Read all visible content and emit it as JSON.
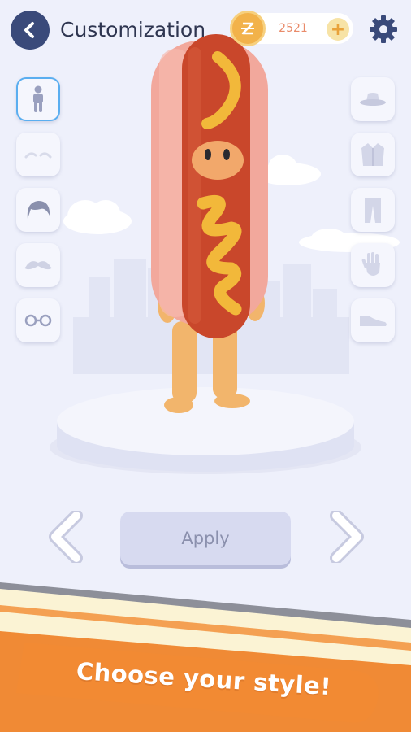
{
  "header": {
    "title": "Customization",
    "coins": "2521",
    "add_coin_label": "+",
    "back_icon": "chevron-left-icon",
    "settings_icon": "gear-icon"
  },
  "left_slots": [
    {
      "name": "body",
      "icon": "person-icon",
      "selected": true
    },
    {
      "name": "eyebrows",
      "icon": "eyebrows-icon",
      "selected": false
    },
    {
      "name": "hair",
      "icon": "hair-icon",
      "selected": false
    },
    {
      "name": "mustache",
      "icon": "mustache-icon",
      "selected": false
    },
    {
      "name": "glasses",
      "icon": "glasses-icon",
      "selected": false
    }
  ],
  "right_slots": [
    {
      "name": "hat",
      "icon": "hat-icon"
    },
    {
      "name": "jacket",
      "icon": "jacket-icon"
    },
    {
      "name": "pants",
      "icon": "pants-icon"
    },
    {
      "name": "gloves",
      "icon": "glove-icon"
    },
    {
      "name": "shoes",
      "icon": "shoe-icon"
    }
  ],
  "character": {
    "costume": "hot-dog-costume"
  },
  "controls": {
    "apply_label": "Apply",
    "prev_icon": "chevron-left-icon",
    "next_icon": "chevron-right-icon"
  },
  "banner": {
    "text": "Choose your style!"
  },
  "colors": {
    "background": "#eef0fb",
    "accent_dark": "#3a4a7a",
    "banner_orange": "#f08a35",
    "coin_gold": "#f2b24a",
    "sausage": "#c9472b",
    "bun": "#f2a89c",
    "mustard": "#f2b83a"
  }
}
